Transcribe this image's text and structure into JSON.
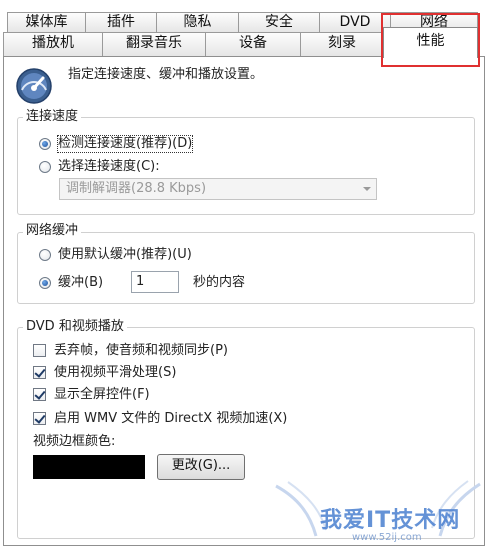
{
  "tabs_row1": [
    {
      "label": "媒体库"
    },
    {
      "label": "插件"
    },
    {
      "label": "隐私"
    },
    {
      "label": "安全"
    },
    {
      "label": "DVD"
    },
    {
      "label": "网络"
    }
  ],
  "tabs_row2": [
    {
      "label": "播放机"
    },
    {
      "label": "翻录音乐"
    },
    {
      "label": "设备"
    },
    {
      "label": "刻录"
    },
    {
      "label": "性能"
    }
  ],
  "selected_tab": "性能",
  "header": {
    "description": "指定连接速度、缓冲和播放设置。",
    "icon": "gauge-icon"
  },
  "connection_speed": {
    "title": "连接速度",
    "detect_label": "检测连接速度(推荐)(D)",
    "choose_label": "选择连接速度(C):",
    "selected": "detect",
    "speed_value": "调制解调器(28.8 Kbps)"
  },
  "network_buffering": {
    "title": "网络缓冲",
    "default_label": "使用默认缓冲(推荐)(U)",
    "buffer_label": "缓冲(B)",
    "buffer_value": "1",
    "buffer_suffix": "秒的内容",
    "selected": "buffer"
  },
  "dvd_video": {
    "title": "DVD 和视频播放",
    "options": [
      {
        "label": "丢弃帧，使音频和视频同步(P)",
        "checked": false
      },
      {
        "label": "使用视频平滑处理(S)",
        "checked": true
      },
      {
        "label": "显示全屏控件(F)",
        "checked": true
      },
      {
        "label": "启用 WMV 文件的 DirectX 视频加速(X)",
        "checked": true
      }
    ],
    "border_color_label": "视频边框颜色:",
    "border_color": "#000000",
    "change_button": "更改(G)..."
  },
  "watermark": {
    "text": "我爱IT技术网",
    "url": "www.52ij.com"
  },
  "colors": {
    "highlight_box": "#e03030",
    "panel_border": "#8f8f8f"
  }
}
